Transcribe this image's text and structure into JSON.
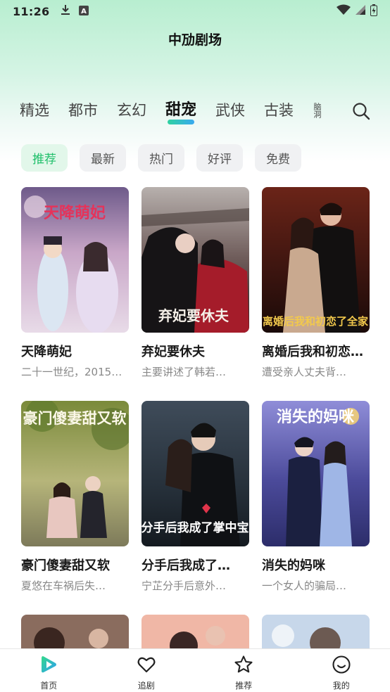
{
  "status_bar": {
    "time": "11:26",
    "icons": [
      "download-icon",
      "a-icon",
      "wifi-icon",
      "signal-icon",
      "battery-icon"
    ]
  },
  "app": {
    "title": "中劢剧场"
  },
  "category_tabs": [
    {
      "label": "精选",
      "active": false
    },
    {
      "label": "都市",
      "active": false
    },
    {
      "label": "玄幻",
      "active": false
    },
    {
      "label": "甜宠",
      "active": true
    },
    {
      "label": "武侠",
      "active": false
    },
    {
      "label": "古装",
      "active": false
    },
    {
      "label": "脑洞",
      "active": false,
      "partial": true
    }
  ],
  "filters": [
    {
      "label": "推荐",
      "active": true
    },
    {
      "label": "最新",
      "active": false
    },
    {
      "label": "热门",
      "active": false
    },
    {
      "label": "好评",
      "active": false
    },
    {
      "label": "免费",
      "active": false
    }
  ],
  "dramas": [
    {
      "title": "天降萌妃",
      "desc": "二十一世纪，2015年…",
      "poster_text": "天降萌妃"
    },
    {
      "title": "弃妃要休夫",
      "desc": "主要讲述了韩若…",
      "poster_text": "弃妃要休夫"
    },
    {
      "title": "离婚后我和初恋…",
      "desc": "遭受亲人丈夫背…",
      "poster_text": "离婚后我和初恋了全家"
    },
    {
      "title": "豪门傻妻甜又软",
      "desc": "夏悠在车祸后失…",
      "poster_text": "豪门傻妻甜又软"
    },
    {
      "title": "分手后我成了…",
      "desc": "宁芷分手后意外…",
      "poster_text": "分手后我成了掌中宝"
    },
    {
      "title": "消失的妈咪",
      "desc": "一个女人的骗局…",
      "poster_text": "消失的妈咪"
    }
  ],
  "bottom_nav": [
    {
      "label": "首页",
      "icon": "home-play-icon",
      "active": true
    },
    {
      "label": "追剧",
      "icon": "heart-icon",
      "active": false
    },
    {
      "label": "推荐",
      "icon": "star-icon",
      "active": false
    },
    {
      "label": "我的",
      "icon": "smile-icon",
      "active": false
    }
  ],
  "colors": {
    "accent_green": "#1fbf6a",
    "tab_underline_start": "#2fd2a0",
    "tab_underline_end": "#39a9f0",
    "chip_bg": "#f0f1f3",
    "chip_active_bg": "#e2f7ea"
  }
}
